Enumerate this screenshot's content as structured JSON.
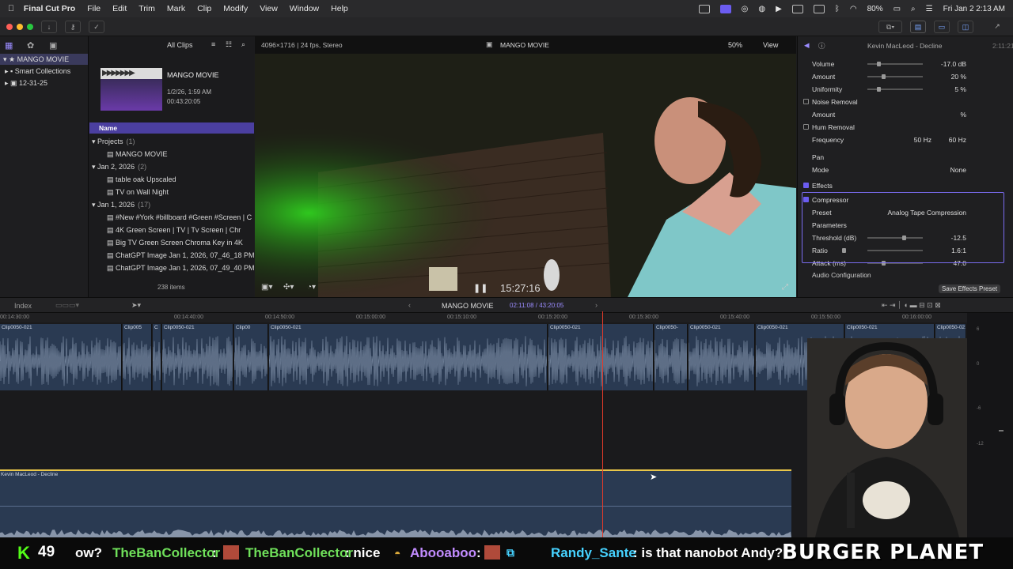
{
  "menubar": {
    "apple": "",
    "app_name": "Final Cut Pro",
    "items": [
      "File",
      "Edit",
      "Trim",
      "Mark",
      "Clip",
      "Modify",
      "View",
      "Window",
      "Help"
    ],
    "battery": "80%",
    "clock": "Fri Jan 2 2:13 AM"
  },
  "library": {
    "items": [
      {
        "label": "MANGO MOVIE",
        "icon": "star-icon"
      },
      {
        "label": "Smart Collections",
        "icon": "folder-icon"
      },
      {
        "label": "12-31-25",
        "icon": "event-icon"
      }
    ]
  },
  "browser": {
    "filter": "All Clips",
    "project_name": "MANGO MOVIE",
    "project_date": "1/2/26, 1:59 AM",
    "project_duration": "00:43:20:05",
    "column_name": "Name",
    "rows": [
      {
        "label": "Projects",
        "count": "(1)",
        "type": "group"
      },
      {
        "label": "MANGO MOVIE",
        "type": "item"
      },
      {
        "label": "Jan 2, 2026",
        "count": "(2)",
        "type": "group"
      },
      {
        "label": "table oak Upscaled",
        "type": "item"
      },
      {
        "label": "TV on Wall Night",
        "type": "item"
      },
      {
        "label": "Jan 1, 2026",
        "count": "(17)",
        "type": "group"
      },
      {
        "label": "#New #York #billboard #Green #Screen | C",
        "type": "item"
      },
      {
        "label": "4K Green Screen | TV | Tv Screen | Chr",
        "type": "item"
      },
      {
        "label": "Big TV Green Screen Chroma Key in 4K",
        "type": "item"
      },
      {
        "label": "ChatGPT Image Jan 1, 2026, 07_46_18 PM",
        "type": "item"
      },
      {
        "label": "ChatGPT Image Jan 1, 2026, 07_49_40 PM",
        "type": "item"
      }
    ],
    "item_count": "238 items"
  },
  "viewer": {
    "format": "4096×1716 | 24 fps, Stereo",
    "title": "MANGO MOVIE",
    "zoom": "50%",
    "view_label": "View",
    "timecode": "15:27:16"
  },
  "inspector": {
    "clip_title": "Kevin MacLeod - Decline",
    "clip_duration": "2:11:21",
    "rows": [
      {
        "label": "Volume",
        "value": "-17.0 dB"
      },
      {
        "label": "Amount",
        "value": "20 %"
      },
      {
        "label": "Uniformity",
        "value": "5 %"
      },
      {
        "label": "Noise Removal",
        "value": ""
      },
      {
        "label": "Amount",
        "value": "%"
      },
      {
        "label": "Hum Removal",
        "value": ""
      },
      {
        "label": "Frequency",
        "value": "50 Hz",
        "value2": "60 Hz"
      },
      {
        "label": "Pan",
        "value": ""
      },
      {
        "label": "Mode",
        "value": "None"
      },
      {
        "label": "Effects",
        "value": ""
      },
      {
        "label": "Compressor",
        "value": ""
      },
      {
        "label": "Preset",
        "value": "Analog Tape Compression"
      },
      {
        "label": "Parameters",
        "value": ""
      },
      {
        "label": "Threshold (dB)",
        "value": "-12.5"
      },
      {
        "label": "Ratio",
        "value": "1.6:1"
      },
      {
        "label": "Attack (ms)",
        "value": "47.0"
      }
    ],
    "audio_config": "Audio Configuration",
    "save_preset": "Save Effects Preset"
  },
  "timeline": {
    "index_label": "Index",
    "project": "MANGO MOVIE",
    "position": "02:11:08 / 43:20:05",
    "ruler_labels": [
      "00:14:30:00",
      "00:14:40:00",
      "00:14:50:00",
      "00:15:00:00",
      "00:15:10:00",
      "00:15:20:00",
      "00:15:30:00",
      "00:15:40:00",
      "00:15:50:00",
      "00:16:00:00"
    ],
    "clip_labels": [
      "Clip0050-021",
      "Clip005",
      "C",
      "Clip0050-021",
      "Clip00",
      "Clip0050-021",
      "Clip0050-021",
      "Clip0050-",
      "Clip0050-021",
      "Clip0050-021",
      "Clip0050-021",
      "Clip0050-021"
    ],
    "audio_clip": "Kevin MacLeod - Decline",
    "meter_labels": [
      "6",
      "0",
      "-6",
      "-12"
    ]
  },
  "chat": {
    "count": "49",
    "messages": [
      {
        "text": "ow?",
        "color": "#ffffff"
      },
      {
        "user": "TheBanCollector",
        "text": ":",
        "color": "#6fe05a"
      },
      {
        "user": "TheBanCollector",
        "text": ": nice",
        "color": "#6fe05a"
      },
      {
        "user": "Abooaboo",
        "text": ":",
        "color": "#c28cff"
      },
      {
        "user": "Randy_Sante",
        "text": ": is that nanobot Andy?",
        "color": "#46d2ff"
      }
    ],
    "banner": "BURGER PLANET"
  }
}
